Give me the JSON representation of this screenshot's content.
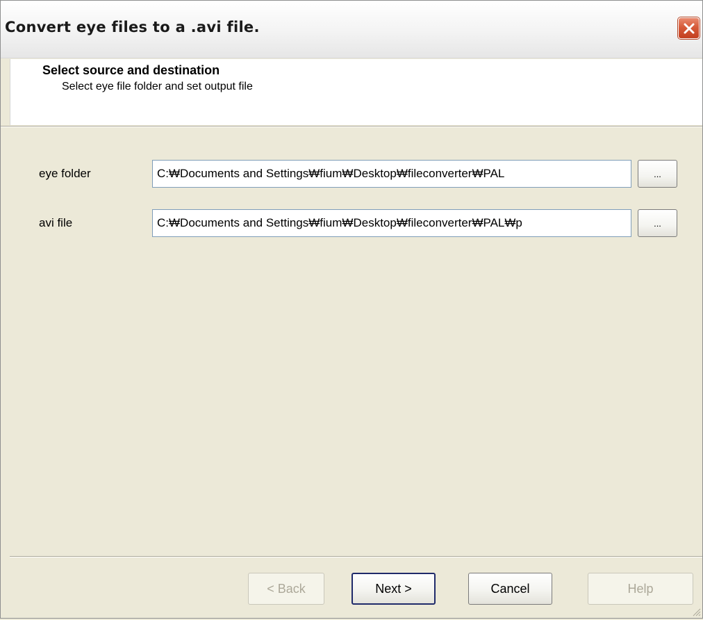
{
  "window": {
    "title": "Convert eye files to a .avi file."
  },
  "header": {
    "title": "Select source and destination",
    "subtitle": "Select eye file folder and set output file"
  },
  "fields": {
    "eye_folder": {
      "label": "eye folder",
      "value": "C:₩Documents and Settings₩fium₩Desktop₩fileconverter₩PAL",
      "browse_label": "..."
    },
    "avi_file": {
      "label": "avi file",
      "value": "C:₩Documents and Settings₩fium₩Desktop₩fileconverter₩PAL₩p",
      "browse_label": "..."
    }
  },
  "buttons": {
    "back_label": "< Back",
    "next_label": "Next >",
    "cancel_label": "Cancel",
    "help_label": "Help"
  },
  "icons": {
    "close": "close-icon",
    "grip": "resize-grip-icon"
  },
  "colors": {
    "window_bg": "#ece9d8",
    "close_accent": "#d65b3a",
    "field_border": "#7f9db9",
    "disabled_text": "#aca899"
  }
}
